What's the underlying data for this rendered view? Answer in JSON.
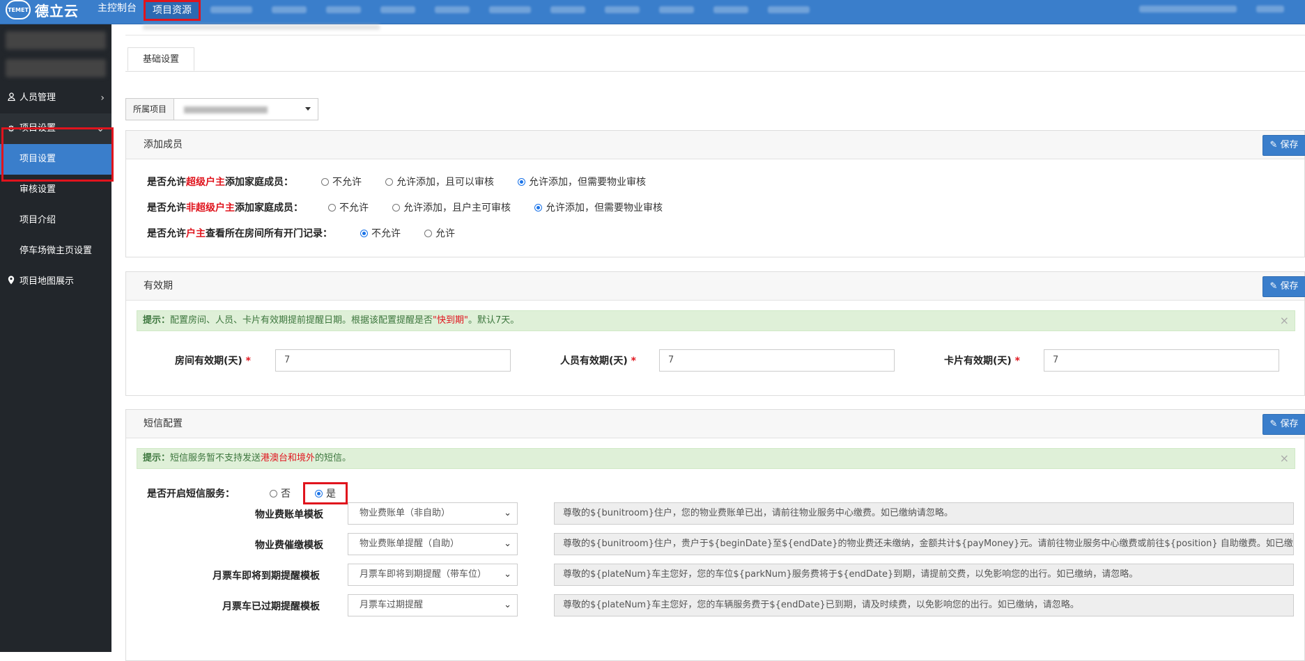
{
  "app": {
    "logo_mark": "TEMET",
    "logo_text": "德立云"
  },
  "topnav": {
    "items": [
      "主控制台",
      "项目资源"
    ]
  },
  "sidebar": {
    "items": [
      {
        "label": "人员管理",
        "icon": "user-icon"
      },
      {
        "label": "项目设置",
        "icon": "gear-icon"
      }
    ],
    "sub_items": [
      "项目设置",
      "审核设置",
      "项目介绍",
      "停车场微主页设置"
    ],
    "map_item": {
      "label": "项目地图展示",
      "icon": "map-pin-icon"
    }
  },
  "tabs": {
    "basic": "基础设置"
  },
  "project": {
    "label": "所属项目"
  },
  "common": {
    "save_label": "保存",
    "tip_prefix": "提示：",
    "close": "×"
  },
  "add_member": {
    "title": "添加成员",
    "rows": [
      {
        "pre": "是否允许",
        "hl": "超级户主",
        "post": "添加家庭成员：",
        "options": [
          "不允许",
          "允许添加，且可以审核",
          "允许添加，但需要物业审核"
        ]
      },
      {
        "pre": "是否允许",
        "hl": "非超级户主",
        "post": "添加家庭成员：",
        "options": [
          "不允许",
          "允许添加，且户主可审核",
          "允许添加，但需要物业审核"
        ]
      },
      {
        "pre": "是否允许",
        "hl": "户主",
        "post": "查看所在房间所有开门记录：",
        "options": [
          "不允许",
          "允许"
        ]
      }
    ]
  },
  "validity": {
    "title": "有效期",
    "tip_text": "配置房间、人员、卡片有效期提前提醒日期。根据该配置提醒是否",
    "tip_highlight": "\"快到期\"",
    "tip_suffix": "。默认7天。",
    "fields": [
      {
        "label": "房间有效期(天)",
        "value": "7"
      },
      {
        "label": "人员有效期(天)",
        "value": "7"
      },
      {
        "label": "卡片有效期(天)",
        "value": "7"
      }
    ],
    "required_mark": "*"
  },
  "sms": {
    "title": "短信配置",
    "tip_text": "短信服务暂不支持发送",
    "tip_highlight": "港澳台和境外",
    "tip_suffix": "的短信。",
    "enable_label": "是否开启短信服务：",
    "options": [
      "否",
      "是"
    ],
    "templates": [
      {
        "label": "物业费账单模板",
        "selected": "物业费账单（非自助）",
        "content": "尊敬的${bunitroom}住户，您的物业费账单已出，请前往物业服务中心缴费。如已缴纳请忽略。"
      },
      {
        "label": "物业费催缴模板",
        "selected": "物业费账单提醒（自助）",
        "content": "尊敬的${bunitroom}住户，贵户于${beginDate}至${endDate}的物业费还未缴纳，金额共计${payMoney}元。请前往物业服务中心缴费或前往${position} 自助缴费。如已缴"
      },
      {
        "label": "月票车即将到期提醒模板",
        "selected": "月票车即将到期提醒（带车位）",
        "content": "尊敬的${plateNum}车主您好，您的车位${parkNum}服务费将于${endDate}到期，请提前交费，以免影响您的出行。如已缴纳，请忽略。"
      },
      {
        "label": "月票车已过期提醒模板",
        "selected": "月票车过期提醒",
        "content": "尊敬的${plateNum}车主您好，您的车辆服务费于${endDate}已到期，请及时续费，以免影响您的出行。如已缴纳，请忽略。"
      }
    ]
  }
}
